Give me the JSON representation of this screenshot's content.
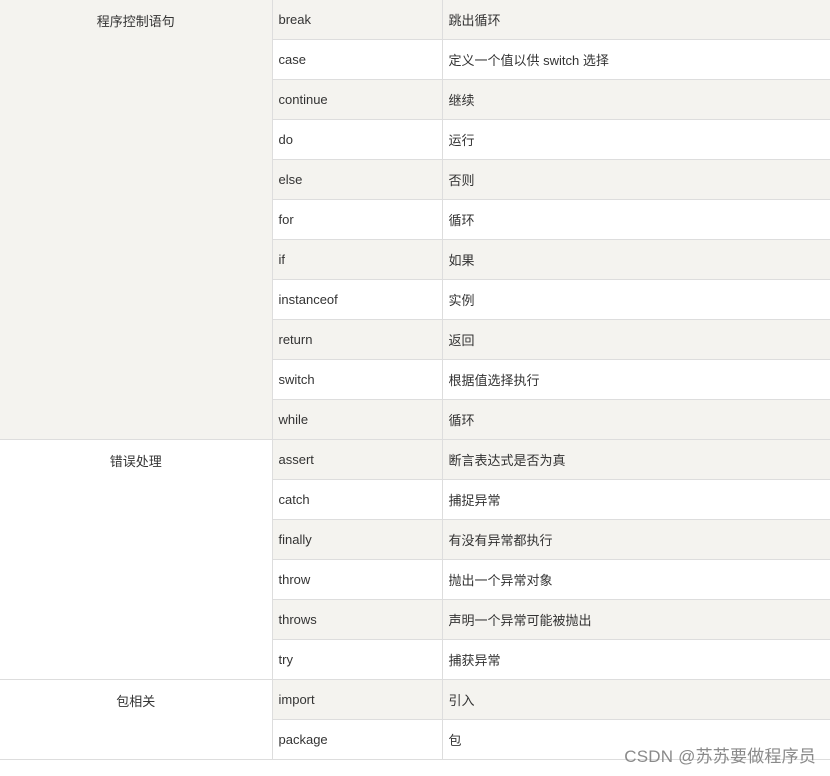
{
  "groups": [
    {
      "label": "程序控制语句",
      "rows": [
        {
          "keyword": "break",
          "desc": "跳出循环"
        },
        {
          "keyword": "case",
          "desc": "定义一个值以供 switch 选择"
        },
        {
          "keyword": "continue",
          "desc": "继续"
        },
        {
          "keyword": "do",
          "desc": "运行"
        },
        {
          "keyword": "else",
          "desc": "否则"
        },
        {
          "keyword": "for",
          "desc": "循环"
        },
        {
          "keyword": "if",
          "desc": "如果"
        },
        {
          "keyword": "instanceof",
          "desc": "实例"
        },
        {
          "keyword": "return",
          "desc": "返回"
        },
        {
          "keyword": "switch",
          "desc": "根据值选择执行"
        },
        {
          "keyword": "while",
          "desc": "循环"
        }
      ]
    },
    {
      "label": "错误处理",
      "rows": [
        {
          "keyword": "assert",
          "desc": "断言表达式是否为真"
        },
        {
          "keyword": "catch",
          "desc": "捕捉异常"
        },
        {
          "keyword": "finally",
          "desc": "有没有异常都执行"
        },
        {
          "keyword": "throw",
          "desc": "抛出一个异常对象"
        },
        {
          "keyword": "throws",
          "desc": "声明一个异常可能被抛出"
        },
        {
          "keyword": "try",
          "desc": "捕获异常"
        }
      ]
    },
    {
      "label": "包相关",
      "rows": [
        {
          "keyword": "import",
          "desc": "引入"
        },
        {
          "keyword": "package",
          "desc": "包"
        }
      ]
    }
  ],
  "watermark": "CSDN @苏苏要做程序员",
  "colors": {
    "shade": "#f4f3ef",
    "border": "#dddddd",
    "text": "#333333"
  }
}
